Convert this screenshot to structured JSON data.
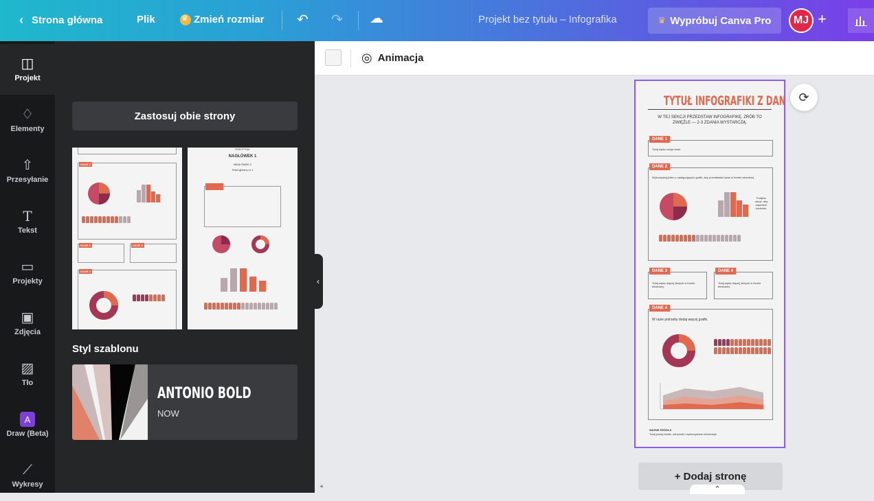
{
  "topbar": {
    "back_label": "Strona główna",
    "file_label": "Plik",
    "resize_label": "Zmień rozmiar",
    "doc_title": "Projekt bez tytułu – Infografika",
    "pro_label": "Wypróbuj Canva Pro",
    "avatar_initials": "MJ",
    "plus": "+",
    "share_icon": "bar-chart-icon"
  },
  "rail": {
    "items": [
      {
        "label": "Projekt",
        "icon": "layout-icon"
      },
      {
        "label": "Elementy",
        "icon": "shapes-icon"
      },
      {
        "label": "Przesyłanie",
        "icon": "cloud-upload-icon"
      },
      {
        "label": "Tekst",
        "icon": "text-icon"
      },
      {
        "label": "Projekty",
        "icon": "folder-icon"
      },
      {
        "label": "Zdjęcia",
        "icon": "image-icon"
      },
      {
        "label": "Tło",
        "icon": "pattern-icon"
      },
      {
        "label": "Draw (Beta)",
        "icon": "draw-icon"
      },
      {
        "label": "Wykresy",
        "icon": "chart-icon"
      }
    ]
  },
  "panel": {
    "apply_label": "Zastosuj obie strony",
    "style_heading": "Styl szablonu",
    "style_font": "ANTONIO BOLD",
    "style_sub": "NOW"
  },
  "thumb2": {
    "top_text": "PODTYTUŁ",
    "heading": "NAGŁÓWEK 1",
    "heading2": "NAGŁÓWEK 2",
    "body": "Tekst główny nr 1"
  },
  "toolbar": {
    "animation_label": "Animacja"
  },
  "infographic": {
    "title": "TYTUŁ INFOGRAFIKI Z DANYMI",
    "subtitle": "W TEJ SEKCJI PRZEDSTAW INFOGRAFIKĘ. ZRÓB TO ZWIĘŹLE — 2-3 ZDANIA WYSTARCZĄ.",
    "dane1_tag": "DANE 1",
    "dane1_text": "Tutaj wpisz swoje dane.",
    "dane2_tag": "DANE 2",
    "dane2_text": "Wykorzystaj jeden z następujących grafik, aby przedstawić dane w formie wizualnej.",
    "dane2_caption": "Podpisz obraz, aby zapewnić kontekst.",
    "dane3_tag": "DANE 3",
    "dane3_text": "Tutaj wpisz więcej danych w formie tekstowej.",
    "dane4_tag": "DANE 4",
    "dane4_text": "Tutaj wpisz więcej danych w formie tekstowej.",
    "dane4b_tag": "DANE 4",
    "dane4b_text": "W razie potrzeby dodaj więcej grafik.",
    "sources_label": "WAŻNE ŹRÓDŁA",
    "sources_text": "Tutaj podaj źródła, odnośniki i wykorzystane informacje."
  },
  "canvas": {
    "add_page_label": "+ Dodaj stronę"
  }
}
